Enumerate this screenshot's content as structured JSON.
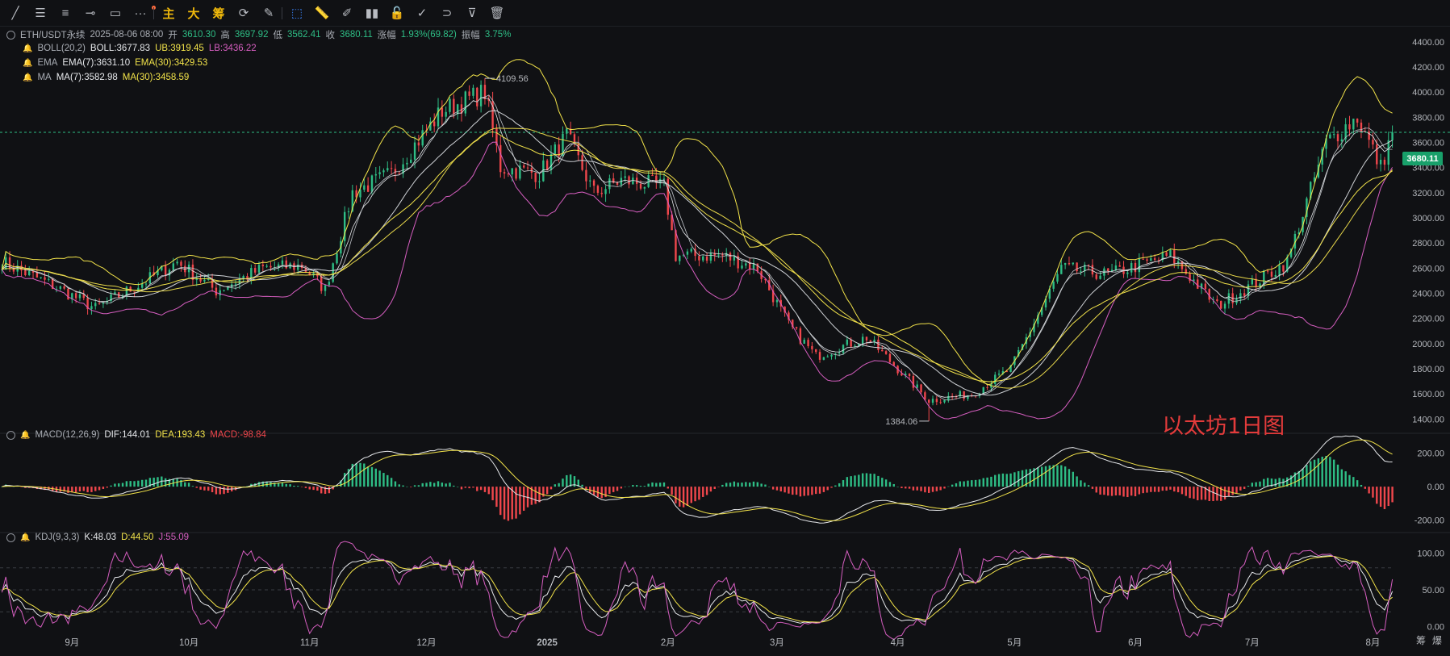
{
  "toolbar": {
    "tools": [
      {
        "name": "trend-line-icon",
        "glyph": "╱"
      },
      {
        "name": "horizontal-lines-icon",
        "glyph": "☰"
      },
      {
        "name": "parallel-lines-icon",
        "glyph": "≡"
      },
      {
        "name": "ray-icon",
        "glyph": "⊸"
      },
      {
        "name": "rectangle-icon",
        "glyph": "▭"
      },
      {
        "name": "more-icon",
        "glyph": "···"
      }
    ],
    "main_label": "主",
    "big_label": "大",
    "chip_label": "筹",
    "tools2": [
      {
        "name": "cycle-icon",
        "glyph": "⟳"
      },
      {
        "name": "brush-icon",
        "glyph": "✎"
      },
      {
        "name": "select-icon",
        "glyph": "⬚"
      },
      {
        "name": "ruler-icon",
        "glyph": "📏"
      },
      {
        "name": "pen-icon",
        "glyph": "✐"
      },
      {
        "name": "candles-icon",
        "glyph": "▮▮"
      },
      {
        "name": "lock-icon",
        "glyph": "🔓"
      },
      {
        "name": "note-icon",
        "glyph": "✓"
      },
      {
        "name": "magnet-icon",
        "glyph": "⊃"
      },
      {
        "name": "filter-icon",
        "glyph": "⊽"
      },
      {
        "name": "trash-icon",
        "glyph": "🗑"
      }
    ]
  },
  "legend": {
    "symbol": "ETH/USDT永续",
    "date": "2025-08-06 08:00",
    "open_label": "开",
    "open": "3610.30",
    "high_label": "高",
    "high": "3697.92",
    "low_label": "低",
    "low": "3562.41",
    "close_label": "收",
    "close": "3680.11",
    "change_label": "涨幅",
    "change": "1.93%(69.82)",
    "amp_label": "振幅",
    "amp": "3.75%",
    "boll_name": "BOLL(20,2)",
    "boll": "BOLL:3677.83",
    "ub": "UB:3919.45",
    "lb": "LB:3436.22",
    "ema_name": "EMA",
    "ema7": "EMA(7):3631.10",
    "ema30": "EMA(30):3429.53",
    "ma_name": "MA",
    "ma7": "MA(7):3582.98",
    "ma30": "MA(30):3458.59",
    "macd_name": "MACD(12,26,9)",
    "dif": "DIF:144.01",
    "dea": "DEA:193.43",
    "macd": "MACD:-98.84",
    "kdj_name": "KDJ(9,3,3)",
    "k": "K:48.03",
    "d": "D:44.50",
    "j": "J:55.09"
  },
  "annotations": {
    "high": "4109.56",
    "low": "1384.06",
    "watermark": "以太坊1日图",
    "last_price": "3680.11"
  },
  "colors": {
    "up": "#2ebd85",
    "down": "#f0474c",
    "white": "#e6e8eb",
    "yellow": "#f2e34a",
    "pink": "#d65ec0",
    "bg": "#101114"
  },
  "corner": {
    "chip": "筹",
    "zoom": "爆"
  },
  "chart_data": [
    {
      "type": "candlestick",
      "title": "",
      "indicators": [
        "BOLL(20,2)",
        "EMA(7)",
        "EMA(30)",
        "MA(7)",
        "MA(30)"
      ],
      "ylim": [
        1300,
        4450
      ],
      "y_ticks": [
        1400,
        1600,
        1800,
        2000,
        2200,
        2400,
        2600,
        2800,
        3000,
        3200,
        3400,
        3600,
        3800,
        4000,
        4200,
        4400
      ],
      "x_ticks": [
        "9月",
        "10月",
        "11月",
        "12月",
        "2025",
        "2月",
        "3月",
        "4月",
        "5月",
        "6月",
        "7月",
        "8月"
      ],
      "close_path": [
        [
          "2024-08-14",
          2650
        ],
        [
          "2024-08-28",
          2450
        ],
        [
          "2024-09-07",
          2280
        ],
        [
          "2024-09-20",
          2500
        ],
        [
          "2024-09-28",
          2650
        ],
        [
          "2024-10-08",
          2420
        ],
        [
          "2024-10-20",
          2600
        ],
        [
          "2024-10-30",
          2620
        ],
        [
          "2024-11-05",
          2430
        ],
        [
          "2024-11-12",
          3200
        ],
        [
          "2024-11-22",
          3350
        ],
        [
          "2024-12-05",
          3850
        ],
        [
          "2024-12-16",
          4000
        ],
        [
          "2024-12-20",
          3400
        ],
        [
          "2024-12-30",
          3350
        ],
        [
          "2025-01-06",
          3650
        ],
        [
          "2025-01-13",
          3200
        ],
        [
          "2025-01-20",
          3300
        ],
        [
          "2025-01-31",
          3250
        ],
        [
          "2025-02-03",
          2700
        ],
        [
          "2025-02-15",
          2700
        ],
        [
          "2025-02-24",
          2600
        ],
        [
          "2025-03-04",
          2150
        ],
        [
          "2025-03-11",
          1900
        ],
        [
          "2025-03-24",
          2050
        ],
        [
          "2025-04-01",
          1800
        ],
        [
          "2025-04-09",
          1550
        ],
        [
          "2025-04-20",
          1600
        ],
        [
          "2025-04-30",
          1800
        ],
        [
          "2025-05-09",
          2350
        ],
        [
          "2025-05-13",
          2600
        ],
        [
          "2025-05-25",
          2550
        ],
        [
          "2025-06-10",
          2700
        ],
        [
          "2025-06-22",
          2300
        ],
        [
          "2025-06-30",
          2450
        ],
        [
          "2025-07-10",
          2650
        ],
        [
          "2025-07-20",
          3600
        ],
        [
          "2025-07-28",
          3800
        ],
        [
          "2025-08-03",
          3400
        ],
        [
          "2025-08-06",
          3680
        ]
      ],
      "high": 4109.56,
      "low": 1384.06,
      "last": 3680.11
    },
    {
      "type": "macd",
      "ylim": [
        -250,
        280
      ],
      "y_ticks": [
        -200,
        0,
        200
      ],
      "dif": 144.01,
      "dea": 193.43,
      "macd": -98.84
    },
    {
      "type": "kdj",
      "ylim": [
        -15,
        115
      ],
      "y_ticks": [
        0,
        50,
        100
      ],
      "k": 48.03,
      "d": 44.5,
      "j": 55.09
    }
  ]
}
